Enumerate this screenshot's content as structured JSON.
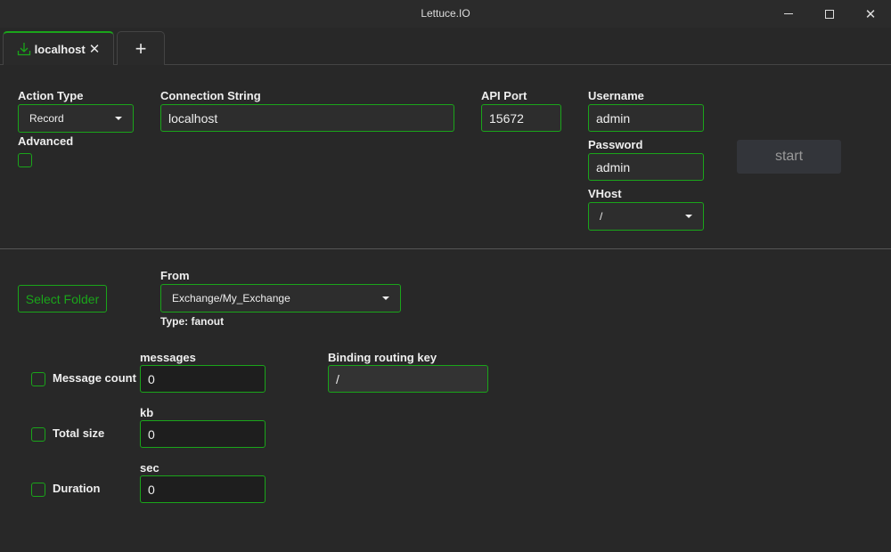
{
  "window": {
    "title": "Lettuce.IO",
    "minimize_icon": "minimize-icon",
    "maximize_icon": "maximize-icon",
    "close_icon": "close-icon"
  },
  "tabs": [
    {
      "label": "localhost",
      "icon": "download-icon",
      "active": true
    },
    {
      "label": "+",
      "icon": "plus-icon"
    }
  ],
  "connection": {
    "action_type_label": "Action Type",
    "action_type_value": "Record",
    "advanced_label": "Advanced",
    "advanced_checked": false,
    "connection_string_label": "Connection String",
    "connection_string_value": "localhost",
    "api_port_label": "API Port",
    "api_port_value": "15672",
    "username_label": "Username",
    "username_value": "admin",
    "password_label": "Password",
    "password_value": "admin",
    "vhost_label": "VHost",
    "vhost_value": "/",
    "start_label": "start"
  },
  "record": {
    "select_folder_label": "Select Folder",
    "from_label": "From",
    "from_value": "Exchange/My_Exchange",
    "type_text": "Type: fanout",
    "binding_label": "Binding routing key",
    "binding_value": "/",
    "limits": [
      {
        "label": "Message count",
        "unit": "messages",
        "value": "0",
        "checked": false
      },
      {
        "label": "Total size",
        "unit": "kb",
        "value": "0",
        "checked": false
      },
      {
        "label": "Duration",
        "unit": "sec",
        "value": "0",
        "checked": false
      }
    ]
  },
  "colors": {
    "accent": "#1aa51a",
    "background": "#282828"
  }
}
